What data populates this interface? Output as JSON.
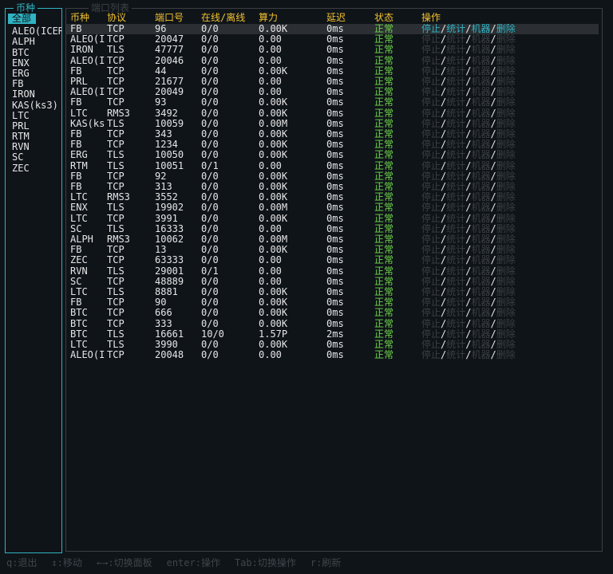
{
  "sidebar": {
    "title": "币种",
    "items": [
      {
        "label": "全部",
        "selected": true
      },
      {
        "label": "ALEO(ICER"
      },
      {
        "label": "ALPH"
      },
      {
        "label": "BTC"
      },
      {
        "label": "ENX"
      },
      {
        "label": "ERG"
      },
      {
        "label": "FB"
      },
      {
        "label": "IRON"
      },
      {
        "label": "KAS(ks3)"
      },
      {
        "label": "LTC"
      },
      {
        "label": "PRL"
      },
      {
        "label": "RTM"
      },
      {
        "label": "RVN"
      },
      {
        "label": "SC"
      },
      {
        "label": "ZEC"
      }
    ]
  },
  "main": {
    "title": "端口列表",
    "headers": {
      "coin": "币种",
      "protocol": "协议",
      "port": "端口号",
      "online": "在线/离线",
      "power": "算力",
      "delay": "延迟",
      "status": "状态",
      "actions": "操作"
    },
    "action_labels": {
      "stop": "停止",
      "stats": "统计",
      "machines": "机器",
      "delete": "删除",
      "separator": "/"
    },
    "rows": [
      {
        "coin": "FB",
        "protocol": "TCP",
        "port": "96",
        "online": "0/0",
        "power": "0.00K",
        "delay": "0ms",
        "status": "正常",
        "selected": true
      },
      {
        "coin": "ALEO(I",
        "protocol": "TCP",
        "port": "20047",
        "online": "0/0",
        "power": "0.00",
        "delay": "0ms",
        "status": "正常"
      },
      {
        "coin": "IRON",
        "protocol": "TLS",
        "port": "47777",
        "online": "0/0",
        "power": "0.00",
        "delay": "0ms",
        "status": "正常"
      },
      {
        "coin": "ALEO(I",
        "protocol": "TCP",
        "port": "20046",
        "online": "0/0",
        "power": "0.00",
        "delay": "0ms",
        "status": "正常"
      },
      {
        "coin": "FB",
        "protocol": "TCP",
        "port": "44",
        "online": "0/0",
        "power": "0.00K",
        "delay": "0ms",
        "status": "正常"
      },
      {
        "coin": "PRL",
        "protocol": "TCP",
        "port": "21677",
        "online": "0/0",
        "power": "0.00",
        "delay": "0ms",
        "status": "正常"
      },
      {
        "coin": "ALEO(I",
        "protocol": "TCP",
        "port": "20049",
        "online": "0/0",
        "power": "0.00",
        "delay": "0ms",
        "status": "正常"
      },
      {
        "coin": "FB",
        "protocol": "TCP",
        "port": "93",
        "online": "0/0",
        "power": "0.00K",
        "delay": "0ms",
        "status": "正常"
      },
      {
        "coin": "LTC",
        "protocol": "RMS3",
        "port": "3492",
        "online": "0/0",
        "power": "0.00K",
        "delay": "0ms",
        "status": "正常"
      },
      {
        "coin": "KAS(ks",
        "protocol": "TLS",
        "port": "10059",
        "online": "0/0",
        "power": "0.00M",
        "delay": "0ms",
        "status": "正常"
      },
      {
        "coin": "FB",
        "protocol": "TCP",
        "port": "343",
        "online": "0/0",
        "power": "0.00K",
        "delay": "0ms",
        "status": "正常"
      },
      {
        "coin": "FB",
        "protocol": "TCP",
        "port": "1234",
        "online": "0/0",
        "power": "0.00K",
        "delay": "0ms",
        "status": "正常"
      },
      {
        "coin": "ERG",
        "protocol": "TLS",
        "port": "10050",
        "online": "0/0",
        "power": "0.00K",
        "delay": "0ms",
        "status": "正常"
      },
      {
        "coin": "RTM",
        "protocol": "TLS",
        "port": "10051",
        "online": "0/1",
        "power": "0.00",
        "delay": "0ms",
        "status": "正常"
      },
      {
        "coin": "FB",
        "protocol": "TCP",
        "port": "92",
        "online": "0/0",
        "power": "0.00K",
        "delay": "0ms",
        "status": "正常"
      },
      {
        "coin": "FB",
        "protocol": "TCP",
        "port": "313",
        "online": "0/0",
        "power": "0.00K",
        "delay": "0ms",
        "status": "正常"
      },
      {
        "coin": "LTC",
        "protocol": "RMS3",
        "port": "3552",
        "online": "0/0",
        "power": "0.00K",
        "delay": "0ms",
        "status": "正常"
      },
      {
        "coin": "ENX",
        "protocol": "TLS",
        "port": "19902",
        "online": "0/0",
        "power": "0.00M",
        "delay": "0ms",
        "status": "正常"
      },
      {
        "coin": "LTC",
        "protocol": "TCP",
        "port": "3991",
        "online": "0/0",
        "power": "0.00K",
        "delay": "0ms",
        "status": "正常"
      },
      {
        "coin": "SC",
        "protocol": "TLS",
        "port": "16333",
        "online": "0/0",
        "power": "0.00",
        "delay": "0ms",
        "status": "正常"
      },
      {
        "coin": "ALPH",
        "protocol": "RMS3",
        "port": "10062",
        "online": "0/0",
        "power": "0.00M",
        "delay": "0ms",
        "status": "正常"
      },
      {
        "coin": "FB",
        "protocol": "TCP",
        "port": "13",
        "online": "0/0",
        "power": "0.00K",
        "delay": "0ms",
        "status": "正常"
      },
      {
        "coin": "ZEC",
        "protocol": "TCP",
        "port": "63333",
        "online": "0/0",
        "power": "0.00",
        "delay": "0ms",
        "status": "正常"
      },
      {
        "coin": "RVN",
        "protocol": "TLS",
        "port": "29001",
        "online": "0/1",
        "power": "0.00",
        "delay": "0ms",
        "status": "正常"
      },
      {
        "coin": "SC",
        "protocol": "TCP",
        "port": "48889",
        "online": "0/0",
        "power": "0.00",
        "delay": "0ms",
        "status": "正常"
      },
      {
        "coin": "LTC",
        "protocol": "TLS",
        "port": "8881",
        "online": "0/0",
        "power": "0.00K",
        "delay": "0ms",
        "status": "正常"
      },
      {
        "coin": "FB",
        "protocol": "TCP",
        "port": "90",
        "online": "0/0",
        "power": "0.00K",
        "delay": "0ms",
        "status": "正常"
      },
      {
        "coin": "BTC",
        "protocol": "TCP",
        "port": "666",
        "online": "0/0",
        "power": "0.00K",
        "delay": "0ms",
        "status": "正常"
      },
      {
        "coin": "BTC",
        "protocol": "TCP",
        "port": "333",
        "online": "0/0",
        "power": "0.00K",
        "delay": "0ms",
        "status": "正常"
      },
      {
        "coin": "BTC",
        "protocol": "TLS",
        "port": "16661",
        "online": "10/0",
        "power": "1.57P",
        "delay": "2ms",
        "status": "正常"
      },
      {
        "coin": "LTC",
        "protocol": "TLS",
        "port": "3990",
        "online": "0/0",
        "power": "0.00K",
        "delay": "0ms",
        "status": "正常"
      },
      {
        "coin": "ALEO(I",
        "protocol": "TCP",
        "port": "20048",
        "online": "0/0",
        "power": "0.00",
        "delay": "0ms",
        "status": "正常"
      }
    ]
  },
  "footer": {
    "hints": [
      "q:退出",
      "↕:移动",
      "←→:切换面板",
      "enter:操作",
      "Tab:切换操作",
      "r:刷新"
    ]
  },
  "colors": {
    "accent": "#30b3c2",
    "header": "#f0c030",
    "ok": "#6fd84a",
    "dim": "#3a3f44",
    "selected_row": "#2b2f33",
    "background": "#0f1419"
  }
}
